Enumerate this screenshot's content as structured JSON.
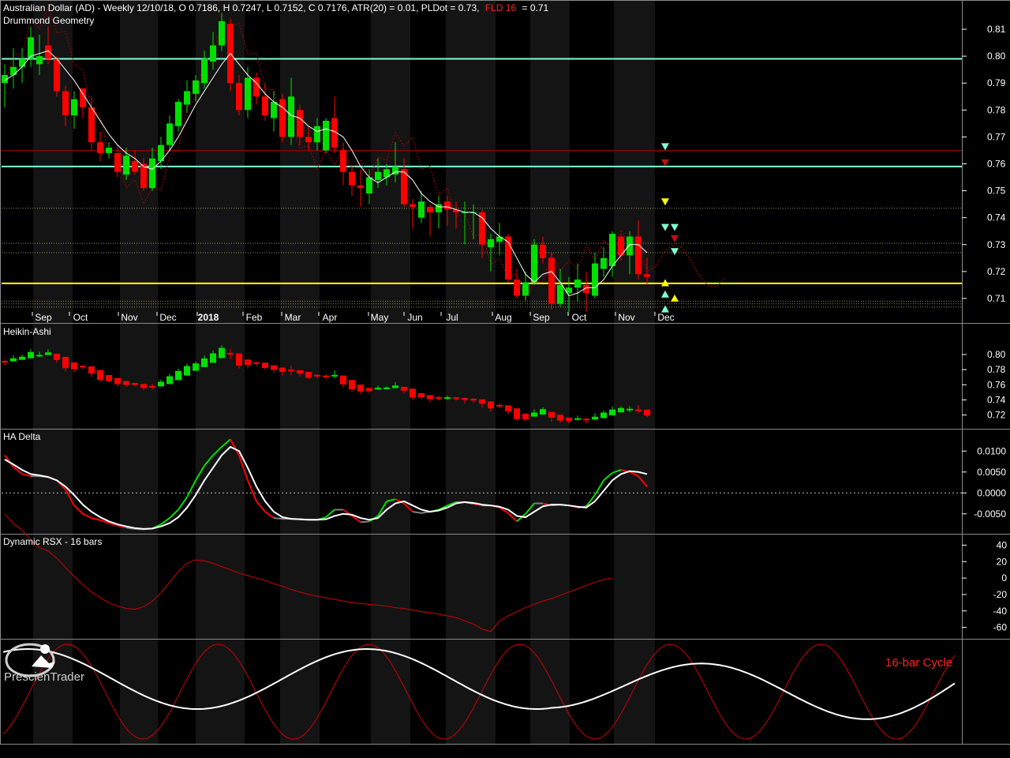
{
  "header": {
    "instrument": "Australian Dollar (AD) - Weekly 12/10/18, O 0.7186, H 0.7247, L 0.7152, C 0.7176, ATR(20) = 0.01, PLDot = 0.73,",
    "fld_label": "FLD 16",
    "fld_value": "= 0.71"
  },
  "panels": {
    "main": "Drummond Geometry",
    "heikin": "Heikin-Ashi",
    "hadelta": "HA Delta",
    "rsx": "Dynamic RSX - 16 bars",
    "cycle_label": "16-bar Cycle"
  },
  "logo": {
    "text": "PrescienTrader"
  },
  "colors": {
    "up": "#00e000",
    "down": "#ff0000",
    "white": "#ffffff",
    "envelope": "#b00000",
    "cyan": "#7fffd4",
    "yellow": "#ffff00",
    "grey": "#808080",
    "divider": "#8a8a8a"
  },
  "chart_data": [
    {
      "type": "candlestick",
      "title": "Drummond Geometry",
      "x_ticks": [
        "Sep",
        "Oct",
        "Nov",
        "Dec",
        "2018",
        "Feb",
        "Mar",
        "Apr",
        "May",
        "Jun",
        "Jul",
        "Aug",
        "Sep",
        "Oct",
        "Nov",
        "Dec"
      ],
      "y_ticks": [
        "0.81",
        "0.80",
        "0.79",
        "0.78",
        "0.77",
        "0.76",
        "0.75",
        "0.74",
        "0.73",
        "0.72",
        "0.71"
      ],
      "ylim": [
        0.705,
        0.815
      ],
      "ohlc": [
        [
          0.79,
          0.797,
          0.781,
          0.793
        ],
        [
          0.793,
          0.803,
          0.788,
          0.796
        ],
        [
          0.796,
          0.803,
          0.79,
          0.799
        ],
        [
          0.799,
          0.811,
          0.796,
          0.807
        ],
        [
          0.797,
          0.808,
          0.793,
          0.8
        ],
        [
          0.804,
          0.811,
          0.797,
          0.799
        ],
        [
          0.799,
          0.8,
          0.785,
          0.787
        ],
        [
          0.787,
          0.789,
          0.774,
          0.778
        ],
        [
          0.778,
          0.787,
          0.773,
          0.784
        ],
        [
          0.788,
          0.788,
          0.777,
          0.781
        ],
        [
          0.781,
          0.785,
          0.765,
          0.768
        ],
        [
          0.768,
          0.772,
          0.761,
          0.764
        ],
        [
          0.764,
          0.768,
          0.762,
          0.766
        ],
        [
          0.764,
          0.767,
          0.755,
          0.757
        ],
        [
          0.756,
          0.766,
          0.754,
          0.763
        ],
        [
          0.761,
          0.765,
          0.756,
          0.757
        ],
        [
          0.76,
          0.762,
          0.75,
          0.751
        ],
        [
          0.751,
          0.766,
          0.75,
          0.762
        ],
        [
          0.761,
          0.77,
          0.758,
          0.767
        ],
        [
          0.767,
          0.778,
          0.765,
          0.775
        ],
        [
          0.774,
          0.784,
          0.772,
          0.783
        ],
        [
          0.782,
          0.791,
          0.779,
          0.787
        ],
        [
          0.786,
          0.793,
          0.783,
          0.791
        ],
        [
          0.79,
          0.802,
          0.788,
          0.799
        ],
        [
          0.798,
          0.809,
          0.795,
          0.804
        ],
        [
          0.804,
          0.816,
          0.802,
          0.813
        ],
        [
          0.812,
          0.814,
          0.787,
          0.79
        ],
        [
          0.79,
          0.793,
          0.778,
          0.78
        ],
        [
          0.78,
          0.796,
          0.777,
          0.792
        ],
        [
          0.792,
          0.794,
          0.782,
          0.785
        ],
        [
          0.785,
          0.79,
          0.776,
          0.778
        ],
        [
          0.777,
          0.787,
          0.772,
          0.783
        ],
        [
          0.784,
          0.786,
          0.768,
          0.77
        ],
        [
          0.77,
          0.792,
          0.767,
          0.785
        ],
        [
          0.78,
          0.782,
          0.767,
          0.77
        ],
        [
          0.77,
          0.774,
          0.765,
          0.768
        ],
        [
          0.768,
          0.777,
          0.765,
          0.774
        ],
        [
          0.765,
          0.777,
          0.764,
          0.776
        ],
        [
          0.777,
          0.785,
          0.764,
          0.766
        ],
        [
          0.765,
          0.768,
          0.752,
          0.757
        ],
        [
          0.757,
          0.759,
          0.748,
          0.752
        ],
        [
          0.752,
          0.758,
          0.744,
          0.751
        ],
        [
          0.749,
          0.758,
          0.745,
          0.755
        ],
        [
          0.754,
          0.762,
          0.751,
          0.757
        ],
        [
          0.755,
          0.76,
          0.752,
          0.758
        ],
        [
          0.756,
          0.768,
          0.753,
          0.759
        ],
        [
          0.758,
          0.762,
          0.744,
          0.745
        ],
        [
          0.745,
          0.747,
          0.736,
          0.744
        ],
        [
          0.74,
          0.75,
          0.738,
          0.746
        ],
        [
          0.744,
          0.745,
          0.733,
          0.742
        ],
        [
          0.742,
          0.748,
          0.736,
          0.745
        ],
        [
          0.746,
          0.748,
          0.737,
          0.743
        ],
        [
          0.743,
          0.746,
          0.736,
          0.742
        ],
        [
          0.742,
          0.746,
          0.73,
          0.742
        ],
        [
          0.742,
          0.745,
          0.732,
          0.742
        ],
        [
          0.742,
          0.743,
          0.725,
          0.73
        ],
        [
          0.729,
          0.734,
          0.72,
          0.732
        ],
        [
          0.731,
          0.738,
          0.726,
          0.733
        ],
        [
          0.733,
          0.734,
          0.716,
          0.717
        ],
        [
          0.717,
          0.721,
          0.71,
          0.711
        ],
        [
          0.711,
          0.72,
          0.709,
          0.716
        ],
        [
          0.716,
          0.732,
          0.715,
          0.73
        ],
        [
          0.73,
          0.733,
          0.723,
          0.725
        ],
        [
          0.725,
          0.727,
          0.706,
          0.708
        ],
        [
          0.708,
          0.721,
          0.707,
          0.715
        ],
        [
          0.712,
          0.718,
          0.705,
          0.714
        ],
        [
          0.714,
          0.723,
          0.709,
          0.717
        ],
        [
          0.715,
          0.72,
          0.705,
          0.712
        ],
        [
          0.711,
          0.727,
          0.71,
          0.723
        ],
        [
          0.721,
          0.729,
          0.718,
          0.725
        ],
        [
          0.722,
          0.735,
          0.718,
          0.734
        ],
        [
          0.733,
          0.734,
          0.724,
          0.726
        ],
        [
          0.726,
          0.735,
          0.719,
          0.733
        ],
        [
          0.733,
          0.739,
          0.717,
          0.719
        ],
        [
          0.719,
          0.725,
          0.715,
          0.718
        ]
      ],
      "pldot": [
        0.791,
        0.793,
        0.796,
        0.8,
        0.801,
        0.802,
        0.799,
        0.795,
        0.791,
        0.786,
        0.781,
        0.776,
        0.771,
        0.767,
        0.764,
        0.762,
        0.759,
        0.758,
        0.761,
        0.765,
        0.77,
        0.776,
        0.782,
        0.787,
        0.792,
        0.797,
        0.801,
        0.797,
        0.793,
        0.79,
        0.786,
        0.783,
        0.781,
        0.778,
        0.777,
        0.774,
        0.772,
        0.773,
        0.772,
        0.77,
        0.765,
        0.759,
        0.755,
        0.753,
        0.755,
        0.757,
        0.757,
        0.754,
        0.749,
        0.746,
        0.744,
        0.744,
        0.743,
        0.742,
        0.742,
        0.74,
        0.736,
        0.733,
        0.731,
        0.725,
        0.719,
        0.716,
        0.719,
        0.72,
        0.716,
        0.711,
        0.712,
        0.714,
        0.714,
        0.717,
        0.722,
        0.726,
        0.73,
        0.73,
        0.727
      ],
      "horizontal_levels": {
        "cyan": [
          0.799,
          0.759
        ],
        "yellow": [
          0.7156
        ],
        "red": [
          0.765
        ]
      },
      "arrows": {
        "cyan_down": [
          0.7665,
          0.7365,
          0.7365,
          0.7275
        ],
        "yellow_down": [
          0.746
        ],
        "yellow_up": [
          0.71
        ],
        "cyan_up": [
          0.7115,
          0.706
        ]
      }
    },
    {
      "type": "candlestick",
      "title": "Heikin-Ashi",
      "y_ticks": [
        "0.80",
        "0.78",
        "0.76",
        "0.74",
        "0.72"
      ],
      "note": "heikin-ashi values derived from the candles above"
    },
    {
      "type": "line",
      "title": "HA Delta",
      "y_ticks": [
        "0.0100",
        "0.0050",
        "0.0000",
        "-0.0050"
      ],
      "ylim": [
        -0.009,
        0.0125
      ],
      "series": [
        {
          "values": [
            0.009,
            0.0062,
            0.0045,
            0.004,
            0.004,
            0.0038,
            0.003,
            0.0008,
            -0.003,
            -0.005,
            -0.006,
            -0.0065,
            -0.0072,
            -0.0078,
            -0.0083,
            -0.0086,
            -0.0087,
            -0.0085,
            -0.0075,
            -0.006,
            -0.004,
            -0.001,
            0.003,
            0.0065,
            0.009,
            0.011,
            0.0128,
            0.009,
            0.003,
            -0.002,
            -0.0045,
            -0.006,
            -0.0062,
            -0.0062,
            -0.0063,
            -0.0064,
            -0.0064,
            -0.0058,
            -0.004,
            -0.004,
            -0.0055,
            -0.007,
            -0.0068,
            -0.0055,
            -0.002,
            -0.0015,
            -0.0025,
            -0.0045,
            -0.0048,
            -0.0045,
            -0.004,
            -0.003,
            -0.0022,
            -0.0022,
            -0.0026,
            -0.003,
            -0.003,
            -0.0035,
            -0.0048,
            -0.0068,
            -0.005,
            -0.0025,
            -0.0025,
            -0.003,
            -0.0028,
            -0.003,
            -0.0035,
            -0.0032,
            -0.0005,
            0.003,
            0.0048,
            0.0055,
            0.005,
            0.004,
            0.0015
          ]
        },
        {
          "values": [
            0.008,
            0.0068,
            0.0055,
            0.0045,
            0.0042,
            0.0038,
            0.003,
            0.0015,
            -0.0005,
            -0.0028,
            -0.0045,
            -0.0058,
            -0.0068,
            -0.0075,
            -0.008,
            -0.0084,
            -0.0086,
            -0.0085,
            -0.008,
            -0.0072,
            -0.0058,
            -0.0035,
            -0.0005,
            0.003,
            0.006,
            0.009,
            0.011,
            0.01,
            0.006,
            0.0015,
            -0.002,
            -0.0045,
            -0.0058,
            -0.0062,
            -0.0063,
            -0.0064,
            -0.0064,
            -0.0063,
            -0.0055,
            -0.005,
            -0.0052,
            -0.006,
            -0.0064,
            -0.006,
            -0.004,
            -0.0025,
            -0.002,
            -0.003,
            -0.004,
            -0.0045,
            -0.0042,
            -0.0035,
            -0.0025,
            -0.0022,
            -0.0024,
            -0.0028,
            -0.003,
            -0.0033,
            -0.004,
            -0.0055,
            -0.0058,
            -0.0045,
            -0.0032,
            -0.0028,
            -0.0028,
            -0.003,
            -0.0033,
            -0.0035,
            -0.002,
            0.0005,
            0.003,
            0.0045,
            0.0052,
            0.005,
            0.0045
          ]
        }
      ]
    },
    {
      "type": "line",
      "title": "Dynamic RSX - 16 bars",
      "y_ticks": [
        "40",
        "20",
        "0",
        "-20",
        "-40",
        "-60"
      ],
      "ylim": [
        -70,
        50
      ],
      "series": [
        {
          "values": [
            78,
            66,
            58,
            46,
            37,
            33,
            24,
            13,
            2,
            -8,
            -17,
            -24,
            -30,
            -34,
            -37,
            -38,
            -35,
            -28,
            -18,
            -5,
            8,
            18,
            22,
            21,
            18,
            14,
            10,
            6,
            3,
            0,
            -3,
            -7,
            -10,
            -14,
            -17,
            -20,
            -22,
            -24,
            -26,
            -28,
            -30,
            -31,
            -32,
            -33,
            -34,
            -36,
            -37,
            -39,
            -41,
            -42,
            -44,
            -46,
            -48,
            -52,
            -56,
            -62,
            -65,
            -52,
            -46,
            -41,
            -36,
            -32,
            -28,
            -25,
            -21,
            -17,
            -13,
            -9,
            -5,
            -2,
            0
          ]
        }
      ]
    },
    {
      "type": "line",
      "title": "16-bar Cycle",
      "note": "sine-like cycle waves; red = 16-bar cycle, white = longer cycle"
    }
  ]
}
